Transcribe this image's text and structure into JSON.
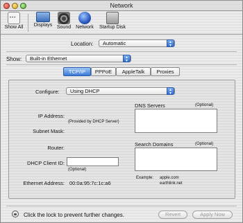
{
  "window": {
    "title": "Network"
  },
  "toolbar": {
    "items": [
      {
        "label": "Show All",
        "icon": "show-all-icon"
      },
      {
        "label": "Displays",
        "icon": "displays-icon"
      },
      {
        "label": "Sound",
        "icon": "sound-icon"
      },
      {
        "label": "Network",
        "icon": "network-icon"
      },
      {
        "label": "Startup Disk",
        "icon": "startup-disk-icon"
      }
    ]
  },
  "location": {
    "label": "Location:",
    "value": "Automatic"
  },
  "show": {
    "label": "Show:",
    "value": "Built-in Ethernet"
  },
  "tabs": [
    {
      "label": "TCP/IP",
      "active": true
    },
    {
      "label": "PPPoE",
      "active": false
    },
    {
      "label": "AppleTalk",
      "active": false
    },
    {
      "label": "Proxies",
      "active": false
    }
  ],
  "tcpip": {
    "configure_label": "Configure:",
    "configure_value": "Using DHCP",
    "ip_label": "IP Address:",
    "ip_note": "(Provided by DHCP Server)",
    "subnet_label": "Subnet Mask:",
    "router_label": "Router:",
    "dhcp_client_label": "DHCP Client ID:",
    "dhcp_client_value": "",
    "dhcp_client_note": "(Optional)",
    "ethernet_label": "Ethernet Address:",
    "ethernet_value": "00:0a:95:7c:1c:a6",
    "dns_label": "DNS Servers",
    "dns_optional": "(Optional)",
    "search_label": "Search Domains",
    "search_optional": "(Optional)",
    "example_label": "Example:",
    "example_line1": "apple.com",
    "example_line2": "earthlink.net"
  },
  "footer": {
    "lock_text": "Click the lock to prevent further changes.",
    "revert_label": "Revert",
    "apply_label": "Apply Now"
  },
  "colors": {
    "accent": "#3a78d8"
  }
}
